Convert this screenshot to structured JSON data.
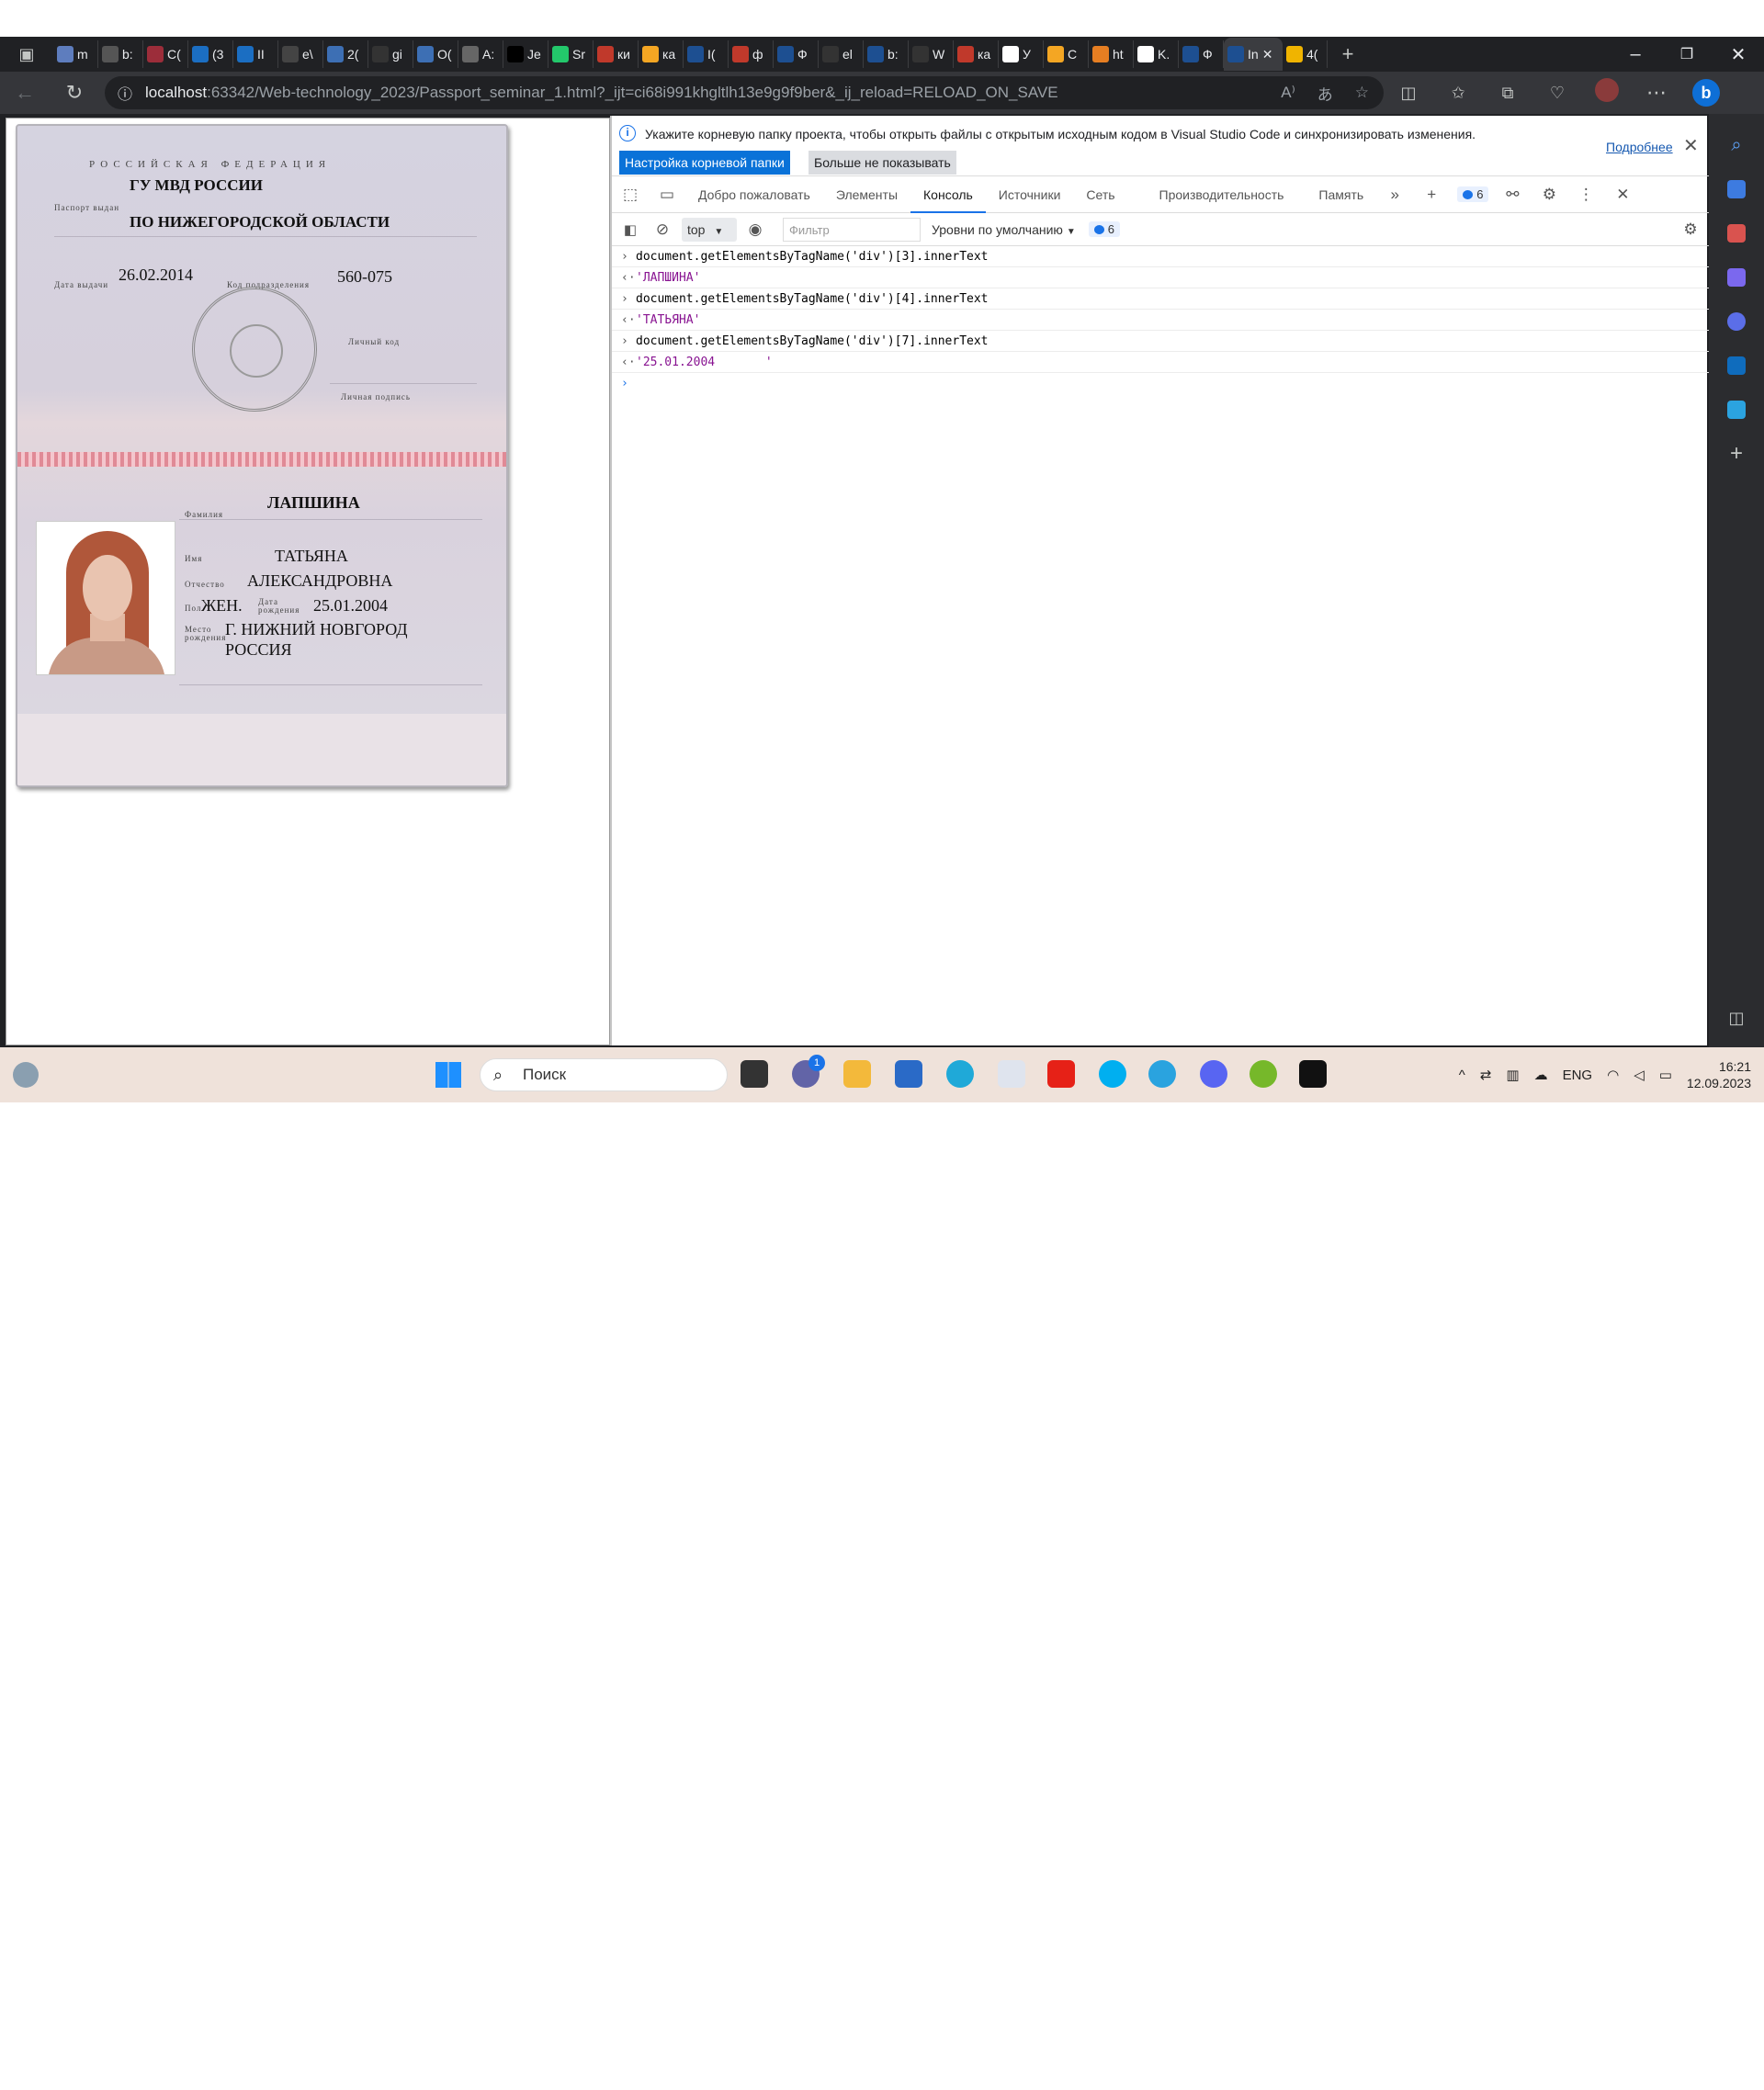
{
  "browser": {
    "tabs": [
      {
        "label": "m",
        "fav": "#5e7dbe"
      },
      {
        "label": "b:",
        "fav": "#555555"
      },
      {
        "label": "C(",
        "fav": "#9c2d3a"
      },
      {
        "label": "(3",
        "fav": "#1b6ec2"
      },
      {
        "label": "II",
        "fav": "#1b6ec2"
      },
      {
        "label": "e\\",
        "fav": "#444444"
      },
      {
        "label": "2(",
        "fav": "#3d6fb4"
      },
      {
        "label": "gi",
        "fav": "#333333"
      },
      {
        "label": "O(",
        "fav": "#3d6fb4"
      },
      {
        "label": "A:",
        "fav": "#666666"
      },
      {
        "label": "Je",
        "fav": "#000000"
      },
      {
        "label": "Sr",
        "fav": "#23c86b"
      },
      {
        "label": "ки",
        "fav": "#c0392b"
      },
      {
        "label": "ка",
        "fav": "#f4a623"
      },
      {
        "label": "I(",
        "fav": "#1d4f91"
      },
      {
        "label": "ф",
        "fav": "#c0392b"
      },
      {
        "label": "Ф",
        "fav": "#1d4f91"
      },
      {
        "label": "el",
        "fav": "#333333"
      },
      {
        "label": "b:",
        "fav": "#1d4f91"
      },
      {
        "label": "W",
        "fav": "#333333"
      },
      {
        "label": "ка",
        "fav": "#c0392b"
      },
      {
        "label": "У",
        "fav": "#ffffff"
      },
      {
        "label": "C",
        "fav": "#f4a623"
      },
      {
        "label": "ht",
        "fav": "#e67e22"
      },
      {
        "label": "K.",
        "fav": "#ffffff"
      },
      {
        "label": "Ф",
        "fav": "#1d4f91"
      },
      {
        "label": "In",
        "fav": "#1d4f91",
        "active": true
      },
      {
        "label": "4(",
        "fav": "#f0b400"
      }
    ],
    "url_host": "localhost",
    "url_rest": ":63342/Web-technology_2023/Passport_seminar_1.html?_ijt=ci68i991khgltlh13e9g9f9ber&_ij_reload=RELOAD_ON_SAVE"
  },
  "passport": {
    "country_caption": "РОССИЙСКАЯ   ФЕДЕРАЦИЯ",
    "issued_caption": "Паспорт выдан",
    "issued_by_line1": "ГУ МВД РОССИИ",
    "issued_by_line2": "ПО НИЖЕГОРОДСКОЙ ОБЛАСТИ",
    "date_caption": "Дата выдачи",
    "issue_date": "26.02.2014",
    "code_caption": "Код подразделения",
    "department_code": "560-075",
    "personal_sig_caption": "Личный код",
    "signature_caption": "Личная подпись",
    "surname_caption": "Фамилия",
    "surname": "ЛАПШИНА",
    "name_caption": "Имя",
    "name": "ТАТЬЯНА",
    "patronymic_caption": "Отчество",
    "patronymic": "АЛЕКСАНДРОВНА",
    "sex_caption": "Пол",
    "sex": "ЖЕН.",
    "birth_caption": "Дата рождения",
    "birth_date": "25.01.2004",
    "birthplace_caption": "Место рождения",
    "birthplace_line1": "Г. НИЖНИЙ НОВГОРОД",
    "birthplace_line2": "РОССИЯ"
  },
  "devtools": {
    "info_message": "Укажите корневую папку проекта, чтобы открыть файлы с открытым исходным кодом в Visual Studio Code и синхронизировать изменения.",
    "info_btn_primary": "Настройка корневой папки",
    "info_btn_secondary": "Больше не показывать",
    "info_more": "Подробнее",
    "tabs": [
      "Добро пожаловать",
      "Элементы",
      "Консоль",
      "Источники",
      "Сеть",
      "Производительность",
      "Память"
    ],
    "active_tab": "Консоль",
    "issues_count": "6",
    "context": "top",
    "filter_placeholder": "Фильтр",
    "levels": "Уровни по умолчанию",
    "messages_count": "6",
    "console": [
      {
        "type": "in",
        "text": "document.getElementsByTagName('div')[3].innerText"
      },
      {
        "type": "out",
        "text": "'ЛАПШИНА'"
      },
      {
        "type": "in",
        "text": "document.getElementsByTagName('div')[4].innerText"
      },
      {
        "type": "out",
        "text": "'ТАТЬЯНА'"
      },
      {
        "type": "in",
        "text": "document.getElementsByTagName('div')[7].innerText"
      },
      {
        "type": "out",
        "text": "'25.01.2004       '"
      }
    ]
  },
  "taskbar": {
    "search_label": "Поиск",
    "language": "ENG",
    "time": "16:21",
    "date": "12.09.2023",
    "chat_badge": "1"
  }
}
